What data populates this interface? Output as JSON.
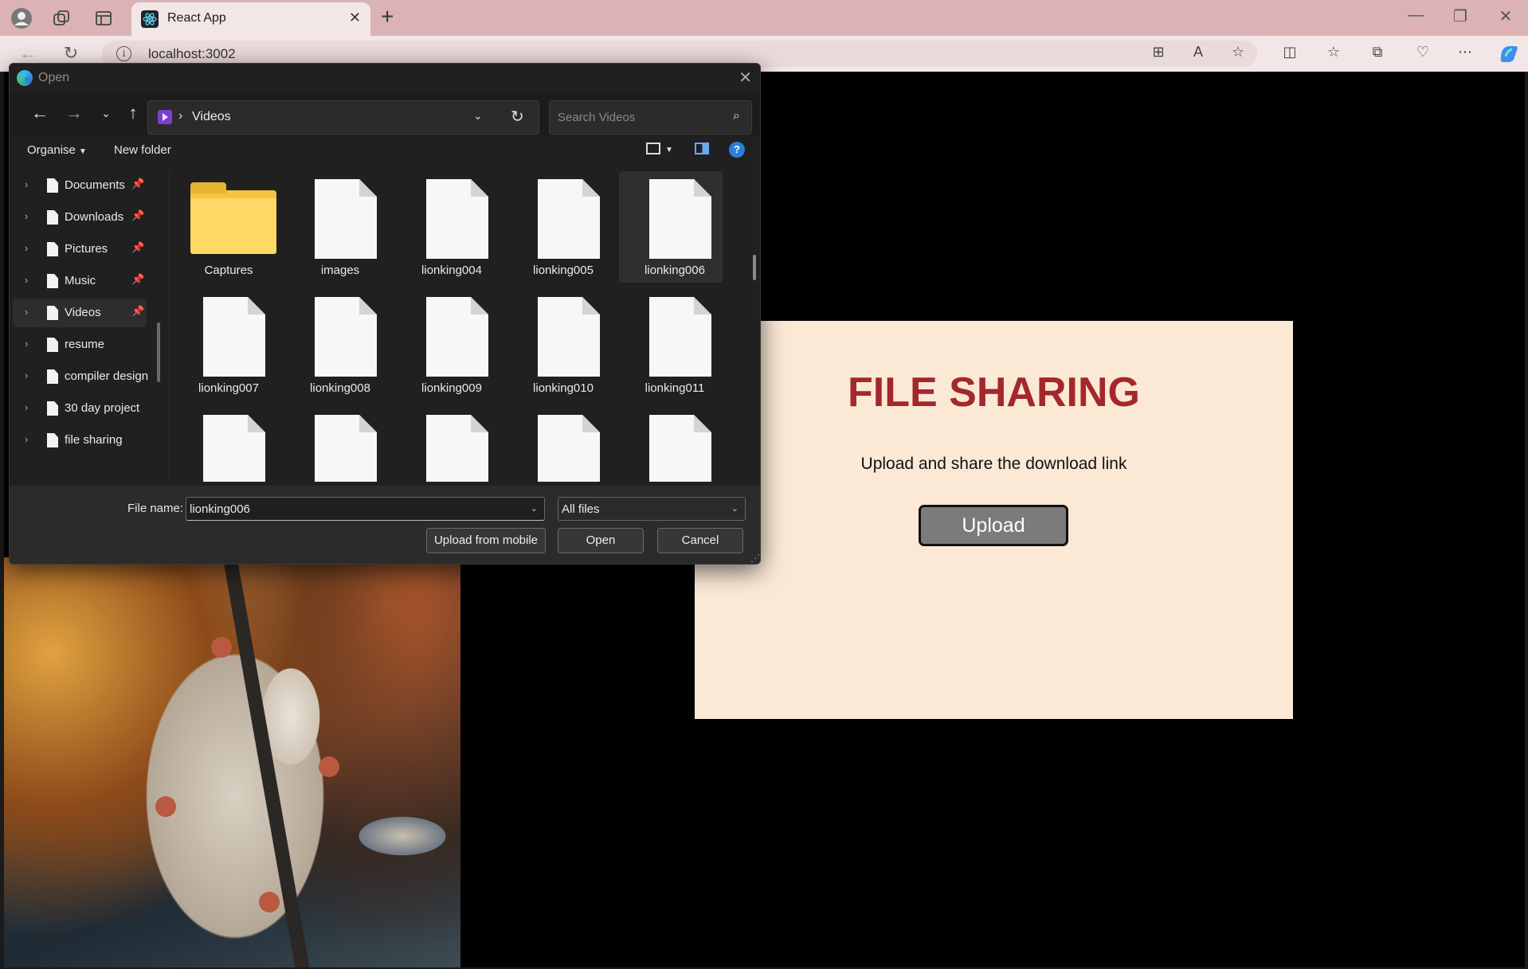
{
  "browser": {
    "tab_title": "React App",
    "url": "localhost:3002",
    "accent": "#dbb3b4"
  },
  "page": {
    "heading": "FILE SHARING",
    "subtitle": "Upload and share the download link",
    "upload_button": "Upload",
    "heading_color": "#a3282b",
    "card_color": "#fbe9d6"
  },
  "dialog": {
    "title": "Open",
    "location": "Videos",
    "search_placeholder": "Search Videos",
    "organise_label": "Organise",
    "new_folder_label": "New folder",
    "sidebar": [
      {
        "label": "Documents",
        "pinned": true,
        "selected": false
      },
      {
        "label": "Downloads",
        "pinned": true,
        "selected": false
      },
      {
        "label": "Pictures",
        "pinned": true,
        "selected": false
      },
      {
        "label": "Music",
        "pinned": true,
        "selected": false
      },
      {
        "label": "Videos",
        "pinned": true,
        "selected": true
      },
      {
        "label": "resume",
        "pinned": false,
        "selected": false
      },
      {
        "label": "compiler design",
        "pinned": false,
        "selected": false
      },
      {
        "label": "30 day project",
        "pinned": false,
        "selected": false
      },
      {
        "label": "file sharing",
        "pinned": false,
        "selected": false
      }
    ],
    "files": [
      {
        "name": "Captures",
        "kind": "folder",
        "selected": false
      },
      {
        "name": "images",
        "kind": "file",
        "selected": false
      },
      {
        "name": "lionking004",
        "kind": "file",
        "selected": false
      },
      {
        "name": "lionking005",
        "kind": "file",
        "selected": false
      },
      {
        "name": "lionking006",
        "kind": "file",
        "selected": true
      },
      {
        "name": "lionking007",
        "kind": "file",
        "selected": false
      },
      {
        "name": "lionking008",
        "kind": "file",
        "selected": false
      },
      {
        "name": "lionking009",
        "kind": "file",
        "selected": false
      },
      {
        "name": "lionking010",
        "kind": "file",
        "selected": false
      },
      {
        "name": "lionking011",
        "kind": "file",
        "selected": false
      },
      {
        "name": "",
        "kind": "file",
        "selected": false
      },
      {
        "name": "",
        "kind": "file",
        "selected": false
      },
      {
        "name": "",
        "kind": "file",
        "selected": false
      },
      {
        "name": "",
        "kind": "file",
        "selected": false
      },
      {
        "name": "",
        "kind": "file",
        "selected": false
      }
    ],
    "file_name_label": "File name:",
    "file_name_value": "lionking006",
    "file_type_value": "All files",
    "upload_mobile_label": "Upload from mobile",
    "open_label": "Open",
    "cancel_label": "Cancel",
    "help_glyph": "?"
  }
}
